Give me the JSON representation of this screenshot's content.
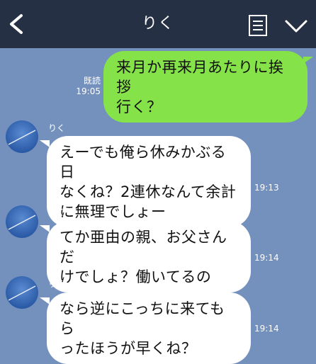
{
  "header": {
    "title": "りく",
    "back_icon": "chevron-left-icon",
    "menu_icon": "notes-icon",
    "dropdown_icon": "chevron-down-icon",
    "background": "#263044"
  },
  "chat_background": "#7491bd",
  "messages": [
    {
      "direction": "sent",
      "text": "来月か再来月あたりに挨拶\n行く？",
      "read_label": "既読",
      "time": "19:05"
    },
    {
      "direction": "received",
      "sender": "りく",
      "text": "えーでも俺ら休みかぶる日\nなくね？2連休なんて余計\nに無理でしょー",
      "time": "19:13"
    },
    {
      "direction": "received",
      "sender": "りく",
      "text": "てか亜由の親、お父さんだ\nけでしょ？働いてるの",
      "time": "19:14"
    },
    {
      "direction": "received",
      "sender": "りく",
      "text": "なら逆にこっちに来てもら\nったほうが早くね？",
      "time": "19:14"
    }
  ],
  "colors": {
    "sent_bubble": "#85e249",
    "received_bubble": "#ffffff"
  }
}
